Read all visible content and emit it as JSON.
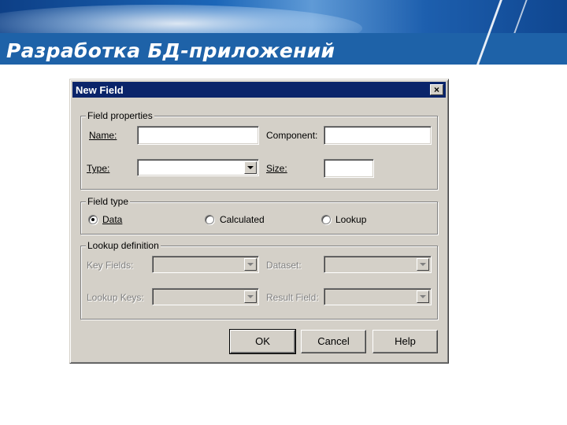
{
  "slide": {
    "title": "Разработка БД-приложений"
  },
  "dialog": {
    "title": "New Field",
    "close_label": "×",
    "field_properties": {
      "legend": "Field properties",
      "name_label": "Name:",
      "name_value": "",
      "component_label": "Component:",
      "component_value": "",
      "type_label": "Type:",
      "type_value": "",
      "size_label": "Size:",
      "size_value": ""
    },
    "field_type": {
      "legend": "Field type",
      "options": [
        {
          "label": "Data",
          "checked": true
        },
        {
          "label": "Calculated",
          "checked": false
        },
        {
          "label": "Lookup",
          "checked": false
        }
      ]
    },
    "lookup_definition": {
      "legend": "Lookup definition",
      "key_fields_label": "Key Fields:",
      "dataset_label": "Dataset:",
      "lookup_keys_label": "Lookup Keys:",
      "result_field_label": "Result Field:"
    },
    "buttons": {
      "ok": "OK",
      "cancel": "Cancel",
      "help": "Help"
    }
  },
  "colors": {
    "header_blue": "#1c5ea4",
    "titlebar": "#0a246a",
    "dialog_face": "#d4d0c8"
  }
}
